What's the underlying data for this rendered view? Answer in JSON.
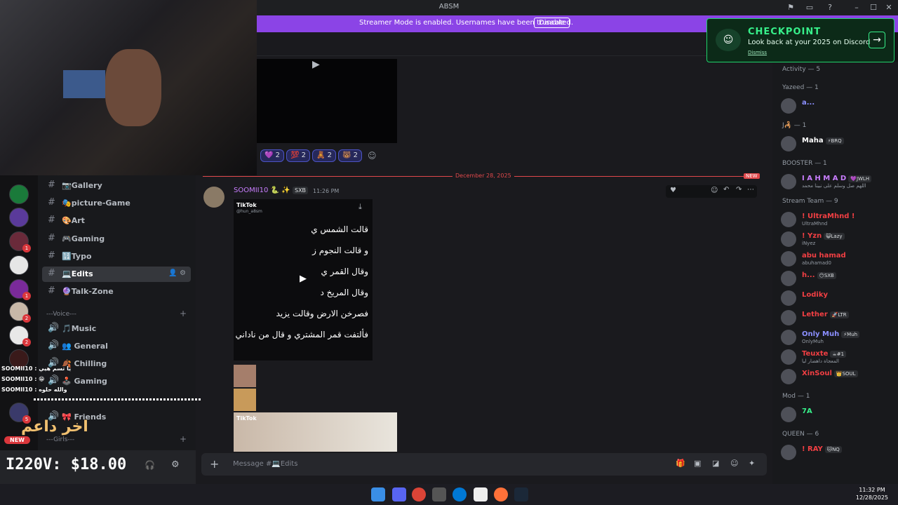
{
  "window": {
    "title": "ABSM",
    "controls": [
      "–",
      "☐",
      "✕"
    ]
  },
  "streamer_banner": {
    "message": "Streamer Mode is enabled. Usernames have been truncated.",
    "button": "Disable"
  },
  "promo": {
    "title": "CHECKPOINT",
    "subtitle": "Look back at your 2025 on Discord",
    "dismiss": "Dismiss"
  },
  "overlay": {
    "donation": "I220V: $18.00",
    "arabic_logo": "اخر داعم",
    "new_label": "NEW"
  },
  "chat_overlay": [
    "SOOMII10 : يا تسم هيي",
    "SOOMII10 : 😁",
    "SOOMII10 : والله حلوه"
  ],
  "channels": {
    "items": [
      {
        "label": "📷Gallery"
      },
      {
        "label": "🎭picture-Game"
      },
      {
        "label": "🎨Art"
      },
      {
        "label": "🎮Gaming"
      },
      {
        "label": "🔢Typo"
      },
      {
        "label": "💻Edits"
      },
      {
        "label": "🔮Talk-Zone"
      }
    ],
    "voice_category": "---Voice---",
    "voice": [
      {
        "label": "🎵Music"
      },
      {
        "label": "👥 General"
      },
      {
        "label": "🍂 Chilling"
      },
      {
        "label": "🕹️ Gaming"
      },
      {
        "label": "🎀 Friends"
      }
    ],
    "girls_category": "---Girls---"
  },
  "server_badges": [
    "1",
    "1",
    "2",
    "2",
    "5"
  ],
  "chat": {
    "reactions": [
      {
        "emoji": "💜",
        "count": "2"
      },
      {
        "emoji": "💯",
        "count": "2"
      },
      {
        "emoji": "🧸",
        "count": "2"
      },
      {
        "emoji": "🐻",
        "count": "2"
      }
    ],
    "divider_date": "December 28, 2025",
    "divider_new": "NEW",
    "message": {
      "author": "SOOMII10",
      "author_emoji": "🐍 ✨",
      "tag": "SXB",
      "time": "11:26 PM",
      "tiktok_label": "TikTok",
      "tiktok_handle": "@hun_a8sm",
      "lines": [
        "قالت الشمس ي",
        "و قالت النجوم ز",
        "وقال القمر ي",
        "وقال المريخ د",
        "فصرخن الارض وقالت يزيد",
        "فألتفت قمر المشتري و قال من ناداني"
      ]
    },
    "input_placeholder": "Message #💻Edits"
  },
  "members": {
    "groups": [
      {
        "name": "Activity — 5",
        "members": []
      },
      {
        "name": "Yazeed — 1",
        "members": [
          {
            "name": "a...",
            "color": "#8b8fff",
            "badge": "",
            "sub": ""
          }
        ]
      },
      {
        "name": "J🦂 — 1",
        "members": [
          {
            "name": "Maha",
            "color": "#ffffff",
            "badge": "⚡BRQ",
            "sub": ""
          }
        ]
      },
      {
        "name": "BOOSTER — 1",
        "members": [
          {
            "name": "I A H M A D",
            "color": "#c97eff",
            "badge": "💜JWLH",
            "sub": "اللهم صل وسلم على نبينا محمد"
          }
        ]
      },
      {
        "name": "Stream Team — 9",
        "members": [
          {
            "name": "! UltraMhnd !",
            "color": "#f23f43",
            "badge": "",
            "sub": "UltraMhnd"
          },
          {
            "name": "! Yzn",
            "color": "#f23f43",
            "badge": "😺Lazy",
            "sub": "iNyez"
          },
          {
            "name": "abu hamad",
            "color": "#f23f43",
            "badge": "",
            "sub": "abuhamad0"
          },
          {
            "name": "h...",
            "color": "#f23f43",
            "badge": "😶SXB",
            "sub": ""
          },
          {
            "name": "Lodiky",
            "color": "#f23f43",
            "badge": "",
            "sub": ""
          },
          {
            "name": "Lether",
            "color": "#f23f43",
            "badge": "🚀LTR",
            "sub": ""
          },
          {
            "name": "Only Muh",
            "color": "#8b8fff",
            "badge": "⚡Muh",
            "sub": "OnlyMuh"
          },
          {
            "name": "Teuxte",
            "color": "#f23f43",
            "badge": "☕#1",
            "sub": "المعجاة داهضار ليا"
          },
          {
            "name": "XinSoul",
            "color": "#f23f43",
            "badge": "👑SOUL",
            "sub": ""
          }
        ]
      },
      {
        "name": "Mod — 1",
        "members": [
          {
            "name": "7A",
            "color": "#37f08a",
            "badge": "",
            "sub": ""
          }
        ]
      },
      {
        "name": "QUEEN — 6",
        "members": [
          {
            "name": "! RAY",
            "color": "#f23f43",
            "badge": "🐱NQ",
            "sub": ""
          }
        ]
      }
    ]
  },
  "clock": {
    "time": "11:32 PM",
    "date": "12/28/2025"
  }
}
